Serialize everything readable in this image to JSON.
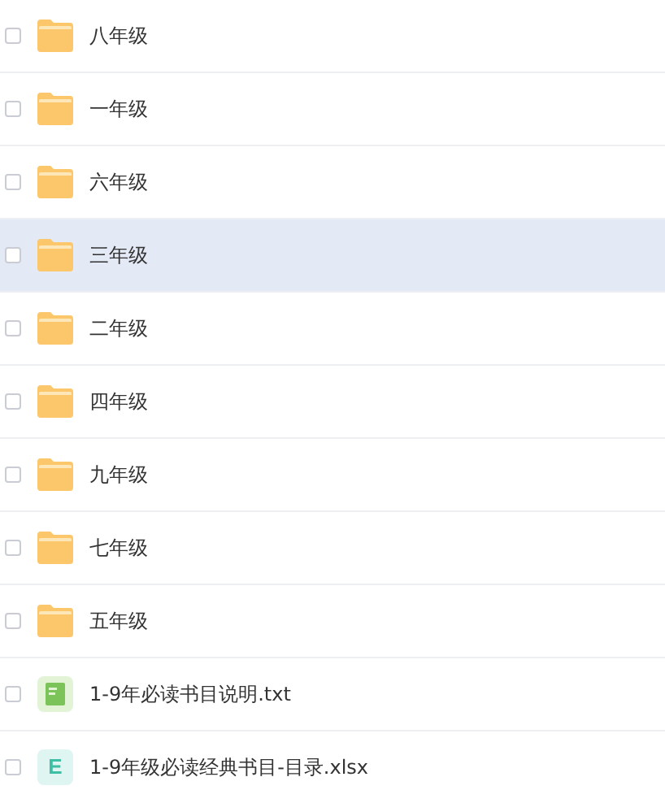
{
  "files": [
    {
      "kind": "folder",
      "name": "八年级",
      "selected": false,
      "checked": false
    },
    {
      "kind": "folder",
      "name": "一年级",
      "selected": false,
      "checked": false
    },
    {
      "kind": "folder",
      "name": "六年级",
      "selected": false,
      "checked": false
    },
    {
      "kind": "folder",
      "name": "三年级",
      "selected": true,
      "checked": false
    },
    {
      "kind": "folder",
      "name": "二年级",
      "selected": false,
      "checked": false
    },
    {
      "kind": "folder",
      "name": "四年级",
      "selected": false,
      "checked": false
    },
    {
      "kind": "folder",
      "name": "九年级",
      "selected": false,
      "checked": false
    },
    {
      "kind": "folder",
      "name": "七年级",
      "selected": false,
      "checked": false
    },
    {
      "kind": "folder",
      "name": "五年级",
      "selected": false,
      "checked": false
    },
    {
      "kind": "txt",
      "name": "1-9年必读书目说明.txt",
      "selected": false,
      "checked": false
    },
    {
      "kind": "xlsx",
      "name": "1-9年级必读经典书目-目录.xlsx",
      "icon_letter": "E",
      "selected": false,
      "checked": false
    }
  ]
}
